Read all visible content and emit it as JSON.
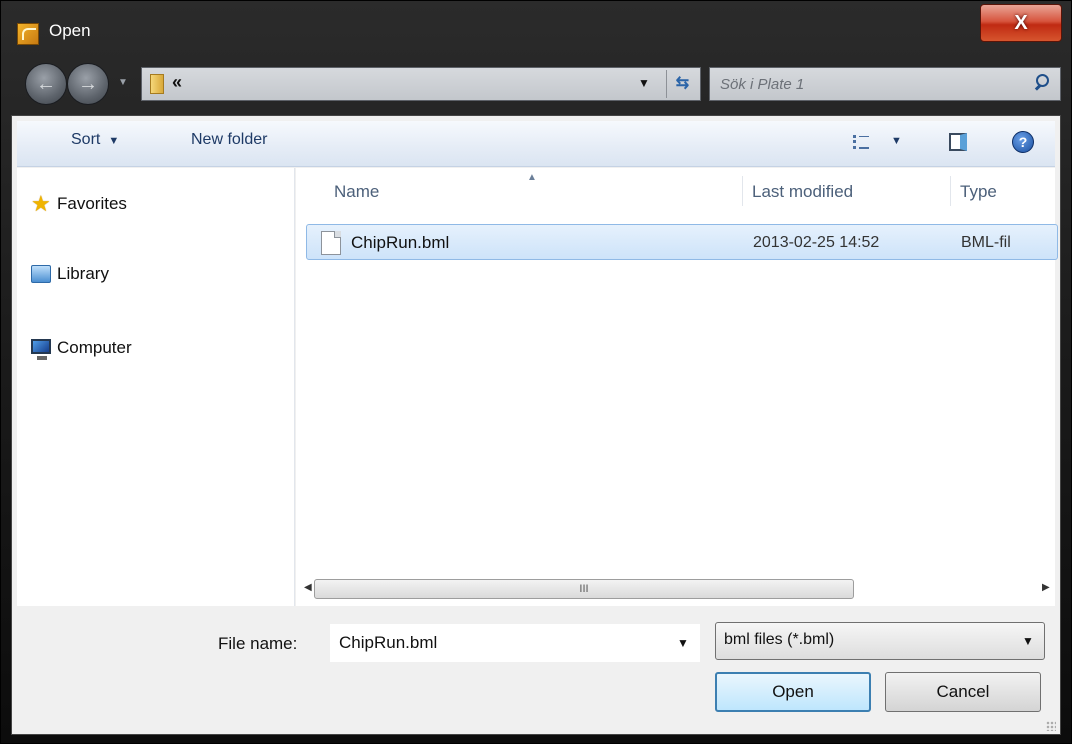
{
  "window": {
    "title": "Open",
    "close_label": "X"
  },
  "nav": {
    "breadcrumb": "«",
    "search_placeholder": "Sök i Plate 1"
  },
  "toolbar": {
    "sort_label": "Sort",
    "new_folder_label": "New folder"
  },
  "sidebar": {
    "items": [
      {
        "label": "Favorites",
        "icon": "star-icon"
      },
      {
        "label": "Library",
        "icon": "library-icon"
      },
      {
        "label": "Computer",
        "icon": "computer-icon"
      }
    ]
  },
  "files": {
    "columns": [
      "Name",
      "Last modified",
      "Type"
    ],
    "rows": [
      {
        "name": "ChipRun.bml",
        "modified": "2013-02-25 14:52",
        "type": "BML-fil"
      }
    ]
  },
  "scrollbar": {
    "thumb_grip": "III"
  },
  "footer": {
    "filename_label": "File name:",
    "filename_value": "ChipRun.bml",
    "filetype_value": "bml files (*.bml)",
    "open_label": "Open",
    "cancel_label": "Cancel"
  },
  "colors": {
    "accent": "#3c7fb1",
    "selection": "#cde3fa",
    "close": "#c02a12"
  }
}
